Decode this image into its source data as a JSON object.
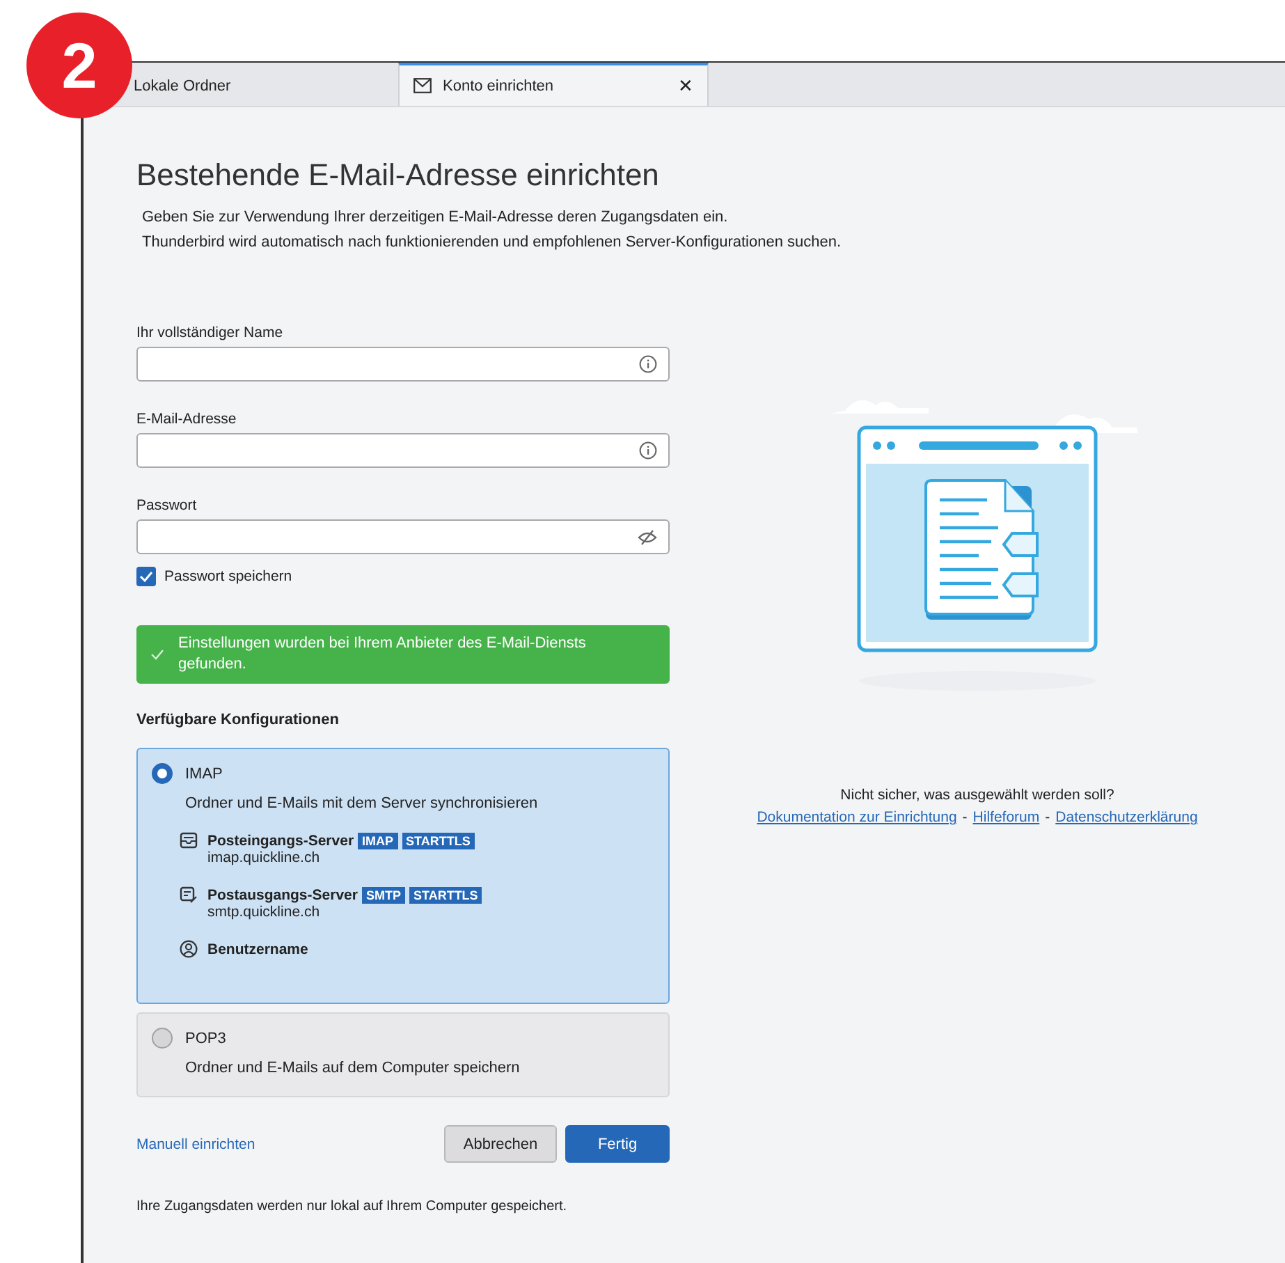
{
  "step_badge": "2",
  "tabs": [
    {
      "label": "Lokale Ordner",
      "selected": false
    },
    {
      "label": "Konto einrichten",
      "selected": true,
      "close": "✕"
    }
  ],
  "title": "Bestehende E-Mail-Adresse einrichten",
  "description": [
    "Geben Sie zur Verwendung Ihrer derzeitigen E-Mail-Adresse deren Zugangsdaten ein.",
    "Thunderbird wird automatisch nach funktionierenden und empfohlenen Server-Konfigurationen suchen."
  ],
  "fields": [
    {
      "label": "Ihr vollständiger Name",
      "kind": "text"
    },
    {
      "label": "E-Mail-Adresse",
      "kind": "text"
    },
    {
      "label": "Passwort",
      "kind": "password"
    }
  ],
  "remember_password": {
    "label": "Passwort speichern",
    "checked": true
  },
  "notice": {
    "kind": "success",
    "text": "Einstellungen wurden bei Ihrem Anbieter des E-Mail-Diensts gefunden."
  },
  "configurations_heading": "Verfügbare Konfigurationen",
  "configurations": [
    {
      "name": "IMAP",
      "selected": true,
      "description": "Ordner und E-Mails mit dem Server synchronisieren",
      "details": [
        {
          "kind": "incoming",
          "label": "Posteingangs-Server",
          "tags": [
            "IMAP",
            "STARTTLS"
          ],
          "value": "imap.quickline.ch"
        },
        {
          "kind": "outgoing",
          "label": "Postausgangs-Server",
          "tags": [
            "SMTP",
            "STARTTLS"
          ],
          "value": "smtp.quickline.ch"
        },
        {
          "kind": "user",
          "label": "Benutzername"
        }
      ]
    },
    {
      "name": "POP3",
      "selected": false,
      "description": "Ordner und E-Mails auf dem Computer speichern"
    }
  ],
  "manual_link": "Manuell einrichten",
  "buttons": [
    {
      "label": "Abbrechen",
      "primary": false
    },
    {
      "label": "Fertig",
      "primary": true
    }
  ],
  "footer": "Ihre Zugangsdaten werden nur lokal auf Ihrem Computer gespeichert.",
  "help": {
    "question": "Nicht sicher, was ausgewählt werden soll?",
    "links": [
      "Dokumentation zur Einrichtung",
      "Hilfeforum",
      "Datenschutzerklärung"
    ],
    "separator": "-"
  }
}
